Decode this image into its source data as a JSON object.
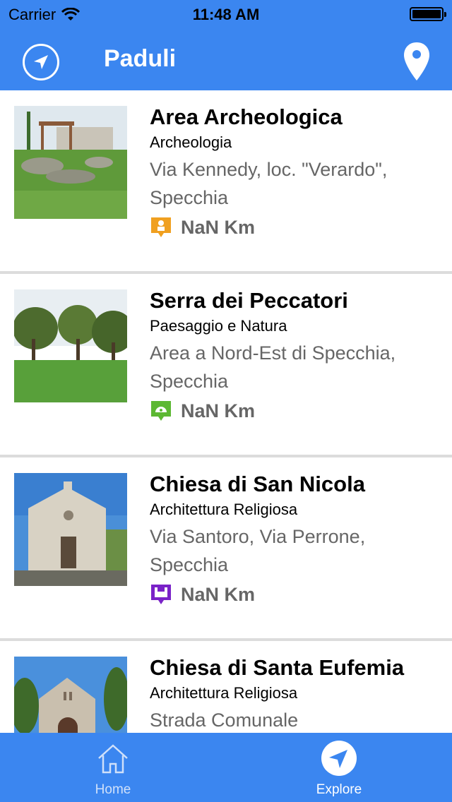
{
  "status_bar": {
    "carrier": "Carrier",
    "time": "11:48 AM"
  },
  "header": {
    "title": "Paduli"
  },
  "icons": {
    "locate": "location-arrow-icon",
    "map": "map-pin-icon"
  },
  "places": [
    {
      "name": "Area Archeologica",
      "category": "Archeologia",
      "address": "Via Kennedy, loc. \"Verardo\", Specchia",
      "distance": "NaN Km",
      "badge_color": "#f0a020",
      "badge_icon": "archeology-icon"
    },
    {
      "name": "Serra dei Peccatori",
      "category": "Paesaggio e Natura",
      "address": "Area a Nord-Est di Specchia, Specchia",
      "distance": "NaN Km",
      "badge_color": "#5cb832",
      "badge_icon": "nature-icon"
    },
    {
      "name": "Chiesa di San Nicola",
      "category": "Architettura Religiosa",
      "address": "Via Santoro, Via Perrone, Specchia",
      "distance": "NaN Km",
      "badge_color": "#7a22c8",
      "badge_icon": "religious-architecture-icon"
    },
    {
      "name": "Chiesa di Santa Eufemia",
      "category": "Architettura Religiosa",
      "address": "Strada Comunale",
      "distance": "",
      "badge_color": "#7a22c8",
      "badge_icon": "religious-architecture-icon"
    }
  ],
  "tabbar": {
    "home_label": "Home",
    "explore_label": "Explore",
    "selected": "Explore"
  },
  "colors": {
    "accent": "#3b86f0"
  }
}
